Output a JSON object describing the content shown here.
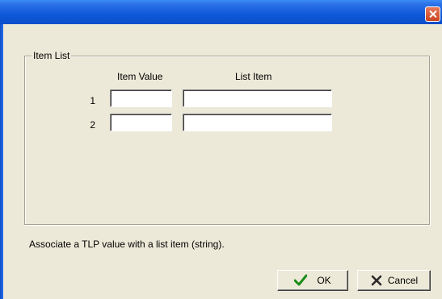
{
  "group": {
    "title": "Item List"
  },
  "columns": {
    "value_header": "Item Value",
    "item_header": "List Item"
  },
  "rows": [
    {
      "number": "1",
      "value": "",
      "item": ""
    },
    {
      "number": "2",
      "value": "",
      "item": ""
    }
  ],
  "description": "Associate a TLP value with a list item (string).",
  "buttons": {
    "ok_label": "OK",
    "cancel_label": "Cancel"
  },
  "icons": {
    "close": "close-icon",
    "ok": "checkmark-icon",
    "cancel": "x-icon"
  },
  "colors": {
    "titlebar": "#0a4ecb",
    "dialog_bg": "#ece9d8",
    "close_button": "#c9431f",
    "checkmark": "#1a8c1a",
    "cancel_x": "#2a2a2a"
  }
}
